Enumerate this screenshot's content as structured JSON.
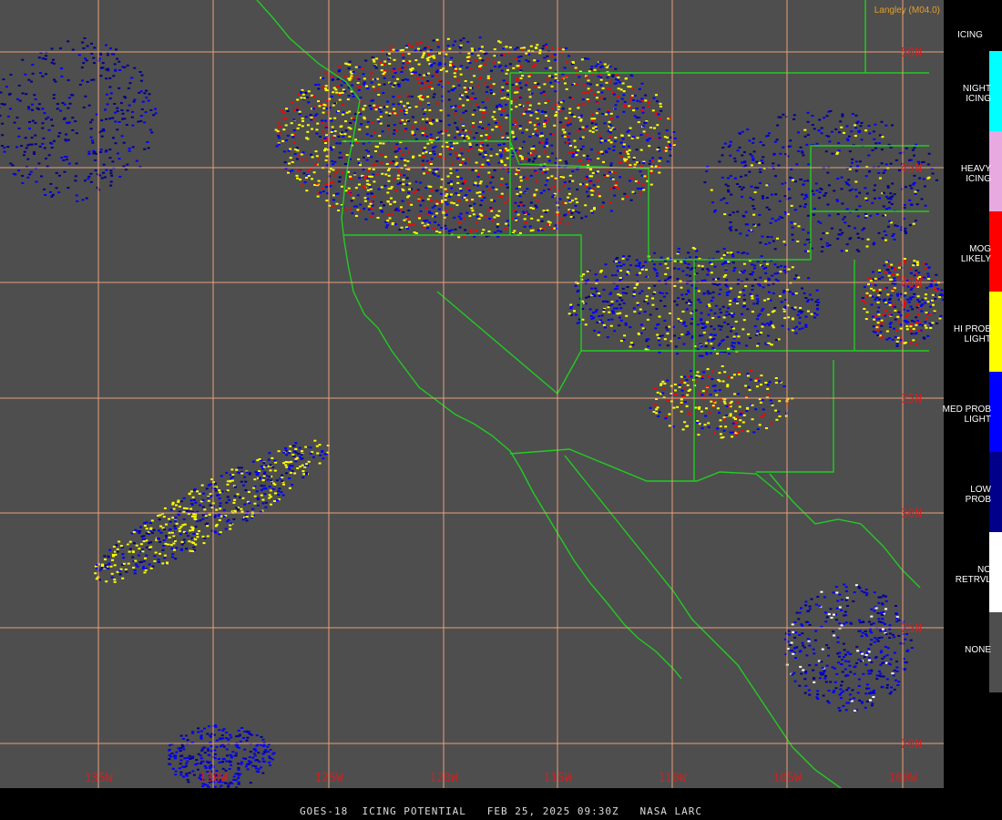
{
  "credit": "Langley (M04.0)",
  "caption": "GOES-18  ICING POTENTIAL   FEB 25, 2025 09:30Z   NASA LARC",
  "legend": {
    "title": "ICING",
    "items": [
      {
        "label": "NIGHT\nICING",
        "color": "#00ffff"
      },
      {
        "label": "HEAVY\nICING",
        "color": "#e8a8e0"
      },
      {
        "label": "MOG\nLIKELY",
        "color": "#ff0000"
      },
      {
        "label": "HI PROB\nLIGHT",
        "color": "#ffff00"
      },
      {
        "label": "MED PROB\nLIGHT",
        "color": "#0000ff"
      },
      {
        "label": "LOW\nPROB",
        "color": "#00008b"
      },
      {
        "label": "NO\nRETRVL",
        "color": "#ffffff"
      },
      {
        "label": "NONE",
        "color": "#4e4e4e"
      }
    ]
  },
  "grid": {
    "longitudes": [
      "135W",
      "130W",
      "125W",
      "120W",
      "115W",
      "110W",
      "105W",
      "100W"
    ],
    "latitudes": [
      "50N",
      "45N",
      "40N",
      "35N",
      "30N",
      "25N",
      "20N"
    ]
  },
  "colors": {
    "background": "#4e4e4e",
    "grid": "#e8a07a",
    "borders": "#22cc22",
    "label": "#cc2222"
  }
}
